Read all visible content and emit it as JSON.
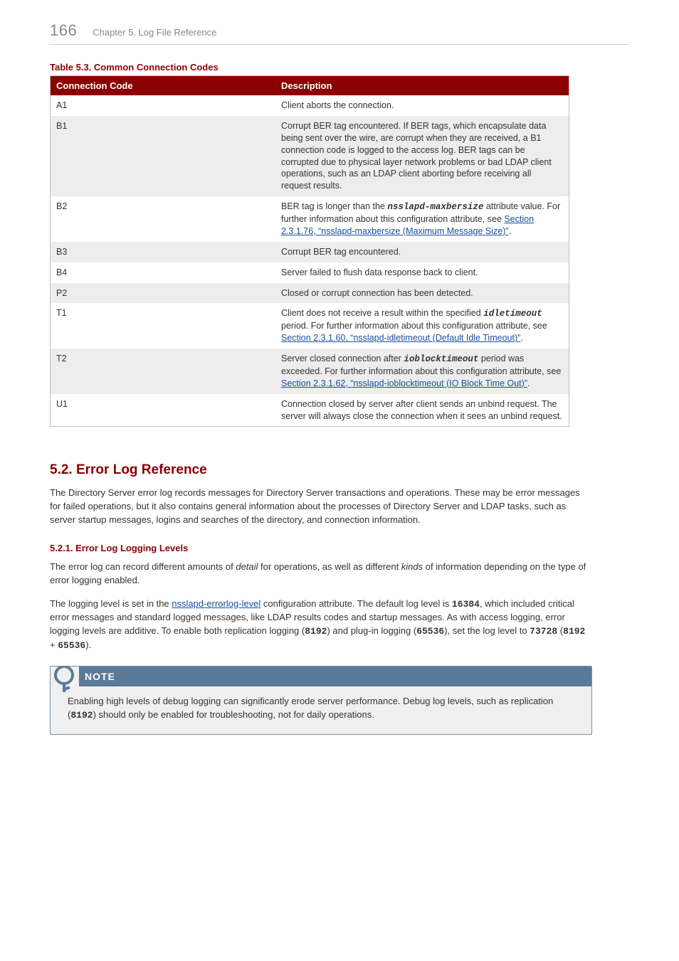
{
  "pageNumber": "166",
  "chapterTitle": "Chapter 5. Log File Reference",
  "tableCaption": "Table 5.3. Common Connection Codes",
  "tableHeaders": {
    "code": "Connection Code",
    "desc": "Description"
  },
  "rows": {
    "a1": {
      "code": "A1",
      "desc": "Client aborts the connection."
    },
    "b1": {
      "code": "B1",
      "desc": "Corrupt BER tag encountered. If BER tags, which encapsulate data being sent over the wire, are corrupt when they are received, a B1 connection code is logged to the access log. BER tags can be corrupted due to physical layer network problems or bad LDAP client operations, such as an LDAP client aborting before receiving all request results."
    },
    "b2": {
      "code": "B2",
      "pre": "BER tag is longer than the ",
      "mono": "nsslapd-maxbersize",
      "mid": " attribute value. For further information about this configuration attribute, see ",
      "link": "Section 2.3.1.76, “nsslapd-maxbersize (Maximum Message Size)”",
      "post": "."
    },
    "b3": {
      "code": "B3",
      "desc": "Corrupt BER tag encountered."
    },
    "b4": {
      "code": "B4",
      "desc": "Server failed to flush data response back to client."
    },
    "p2": {
      "code": "P2",
      "desc": "Closed or corrupt connection has been detected."
    },
    "t1": {
      "code": "T1",
      "pre": "Client does not receive a result within the specified ",
      "mono": "idletimeout",
      "mid": " period. For further information about this configuration attribute, see ",
      "link": "Section 2.3.1.60, “nsslapd-idletimeout (Default Idle Timeout)”",
      "post": "."
    },
    "t2": {
      "code": "T2",
      "pre": "Server closed connection after ",
      "mono": "ioblocktimeout",
      "mid": " period was exceeded. For further information about this configuration attribute, see ",
      "link": "Section 2.3.1.62, “nsslapd-ioblocktimeout (IO Block Time Out)”",
      "post": "."
    },
    "u1": {
      "code": "U1",
      "desc": "Connection closed by server after client sends an unbind request. The server will always close the connection when it sees an unbind request."
    }
  },
  "section": {
    "heading": "5.2. Error Log Reference",
    "para1": "The Directory Server error log records messages for Directory Server transactions and operations. These may be error messages for failed operations, but it also contains general information about the processes of Directory Server and LDAP tasks, such as server startup messages, logins and searches of the directory, and connection information.",
    "subHeading": "5.2.1. Error Log Logging Levels",
    "para2_a": "The error log can record different amounts of ",
    "para2_i1": "detail",
    "para2_b": " for operations, as well as different ",
    "para2_i2": "kinds",
    "para2_c": " of information depending on the type of error logging enabled.",
    "para3_a": "The logging level is set in the ",
    "para3_link": "nsslapd-errorlog-level",
    "para3_b": " configuration attribute. The default log level is ",
    "para3_m1": "16384",
    "para3_c": ", which included critical error messages and standard logged messages, like LDAP results codes and startup messages. As with access logging, error logging levels are additive. To enable both replication logging (",
    "para3_m2": "8192",
    "para3_d": ") and plug-in logging (",
    "para3_m3": "65536",
    "para3_e": "), set the log level to ",
    "para3_m4": "73728",
    "para3_f": " (",
    "para3_m5": "8192",
    "para3_g": " + ",
    "para3_m6": "65536",
    "para3_h": ")."
  },
  "note": {
    "title": "NOTE",
    "text_a": "Enabling high levels of debug logging can significantly erode server performance. Debug log levels, such as replication (",
    "text_m": "8192",
    "text_b": ") should only be enabled for troubleshooting, not for daily operations."
  }
}
